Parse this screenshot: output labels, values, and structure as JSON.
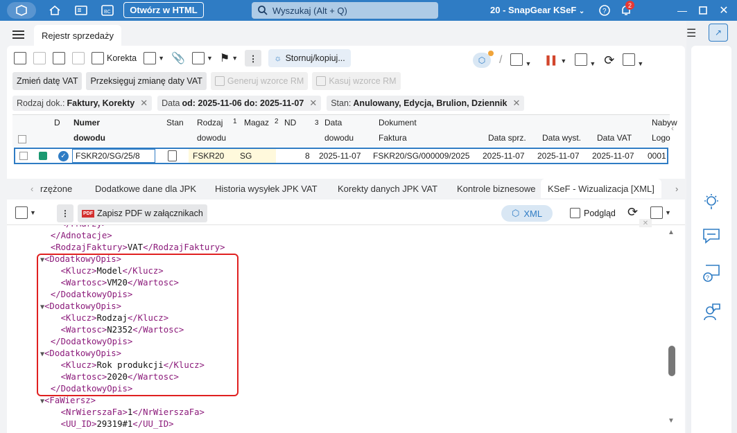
{
  "titlebar": {
    "open_html_label": "Otwórz w HTML",
    "search_placeholder": "Wyszukaj (Alt + Q)",
    "company": "20 - SnapGear KSeF",
    "notif_count": "2"
  },
  "doc_tab": "Rejestr sprzedaży",
  "toolbar": {
    "korekta": "Korekta",
    "stornuj": "Stornuj/kopiuj..."
  },
  "buttons": {
    "zmien_date": "Zmień datę VAT",
    "przesiegnij": "Przeksięguj zmianę daty VAT",
    "generuj": "Generuj wzorce RM",
    "kasuj": "Kasuj wzorce RM"
  },
  "filters": [
    {
      "label": "Rodzaj dok.:",
      "value": "Faktury, Korekty"
    },
    {
      "label": "Data",
      "value": "od: 2025-11-06 do: 2025-11-07"
    },
    {
      "label": "Stan:",
      "value": "Anulowany, Edycja, Brulion, Dziennik"
    }
  ],
  "grid": {
    "headers": {
      "d": "D",
      "numer": "Numer",
      "dowodu": "dowodu",
      "stan": "Stan",
      "rodzaj": "Rodzaj",
      "rodzaj2": "dowodu",
      "magaz": "Magaz",
      "nd": "ND",
      "data": "Data",
      "data2": "dowodu",
      "dokument": "Dokument",
      "faktura": "Faktura",
      "data_sprz": "Data sprz.",
      "data_wyst": "Data wyst.",
      "data_vat": "Data VAT",
      "nabyw": "Nabyw",
      "logo": "Logo",
      "sort1": "1",
      "sort2": "2",
      "sort3": "3"
    },
    "row": {
      "numer": "FSKR20/SG/25/8",
      "rodzaj": "FSKR20",
      "magaz": "SG",
      "nd": "8",
      "data": "2025-11-07",
      "faktura": "FSKR20/SG/000009/2025",
      "data_sprz": "2025-11-07",
      "data_wyst": "2025-11-07",
      "data_vat": "2025-11-07",
      "logo": "0001"
    }
  },
  "bottom_tabs": {
    "t0": "rzężone",
    "t1": "Dodatkowe dane dla JPK",
    "t2": "Historia wysyłek JPK VAT",
    "t3": "Korekty danych JPK VAT",
    "t4": "Kontrole biznesowe",
    "t5": "KSeF - Wizualizacja [XML]"
  },
  "xml_toolbar": {
    "zapisz": "Zapisz PDF w załącznikach",
    "xml": "XML",
    "podglad": "Podgląd"
  },
  "xml_lines": [
    {
      "indent": 1,
      "tri": "",
      "open": "</PMarzy>",
      "text": "",
      "close": ""
    },
    {
      "indent": 0,
      "tri": "",
      "open": "</Adnotacje>",
      "text": "",
      "close": ""
    },
    {
      "indent": 0,
      "tri": "",
      "open": "<RodzajFaktury>",
      "text": "VAT",
      "close": "</RodzajFaktury>"
    },
    {
      "indent": 0,
      "tri": "▼",
      "open": "<DodatkowyOpis>",
      "text": "",
      "close": ""
    },
    {
      "indent": 1,
      "tri": "",
      "open": "<Klucz>",
      "text": "Model",
      "close": "</Klucz>"
    },
    {
      "indent": 1,
      "tri": "",
      "open": "<Wartosc>",
      "text": "VM20",
      "close": "</Wartosc>"
    },
    {
      "indent": 0,
      "tri": "",
      "open": "</DodatkowyOpis>",
      "text": "",
      "close": ""
    },
    {
      "indent": 0,
      "tri": "▼",
      "open": "<DodatkowyOpis>",
      "text": "",
      "close": ""
    },
    {
      "indent": 1,
      "tri": "",
      "open": "<Klucz>",
      "text": "Rodzaj",
      "close": "</Klucz>"
    },
    {
      "indent": 1,
      "tri": "",
      "open": "<Wartosc>",
      "text": "N2352",
      "close": "</Wartosc>"
    },
    {
      "indent": 0,
      "tri": "",
      "open": "</DodatkowyOpis>",
      "text": "",
      "close": ""
    },
    {
      "indent": 0,
      "tri": "▼",
      "open": "<DodatkowyOpis>",
      "text": "",
      "close": ""
    },
    {
      "indent": 1,
      "tri": "",
      "open": "<Klucz>",
      "text": "Rok produkcji",
      "close": "</Klucz>"
    },
    {
      "indent": 1,
      "tri": "",
      "open": "<Wartosc>",
      "text": "2020",
      "close": "</Wartosc>"
    },
    {
      "indent": 0,
      "tri": "",
      "open": "</DodatkowyOpis>",
      "text": "",
      "close": ""
    },
    {
      "indent": 0,
      "tri": "▼",
      "open": "<FaWiersz>",
      "text": "",
      "close": ""
    },
    {
      "indent": 1,
      "tri": "",
      "open": "<NrWierszaFa>",
      "text": "1",
      "close": "</NrWierszaFa>"
    },
    {
      "indent": 1,
      "tri": "",
      "open": "<UU_ID>",
      "text": "29319#1",
      "close": "</UU_ID>"
    }
  ],
  "colors": {
    "accent": "#2f7cc4",
    "highlight_box": "#e02020",
    "xml_tag": "#8b1a7a"
  }
}
